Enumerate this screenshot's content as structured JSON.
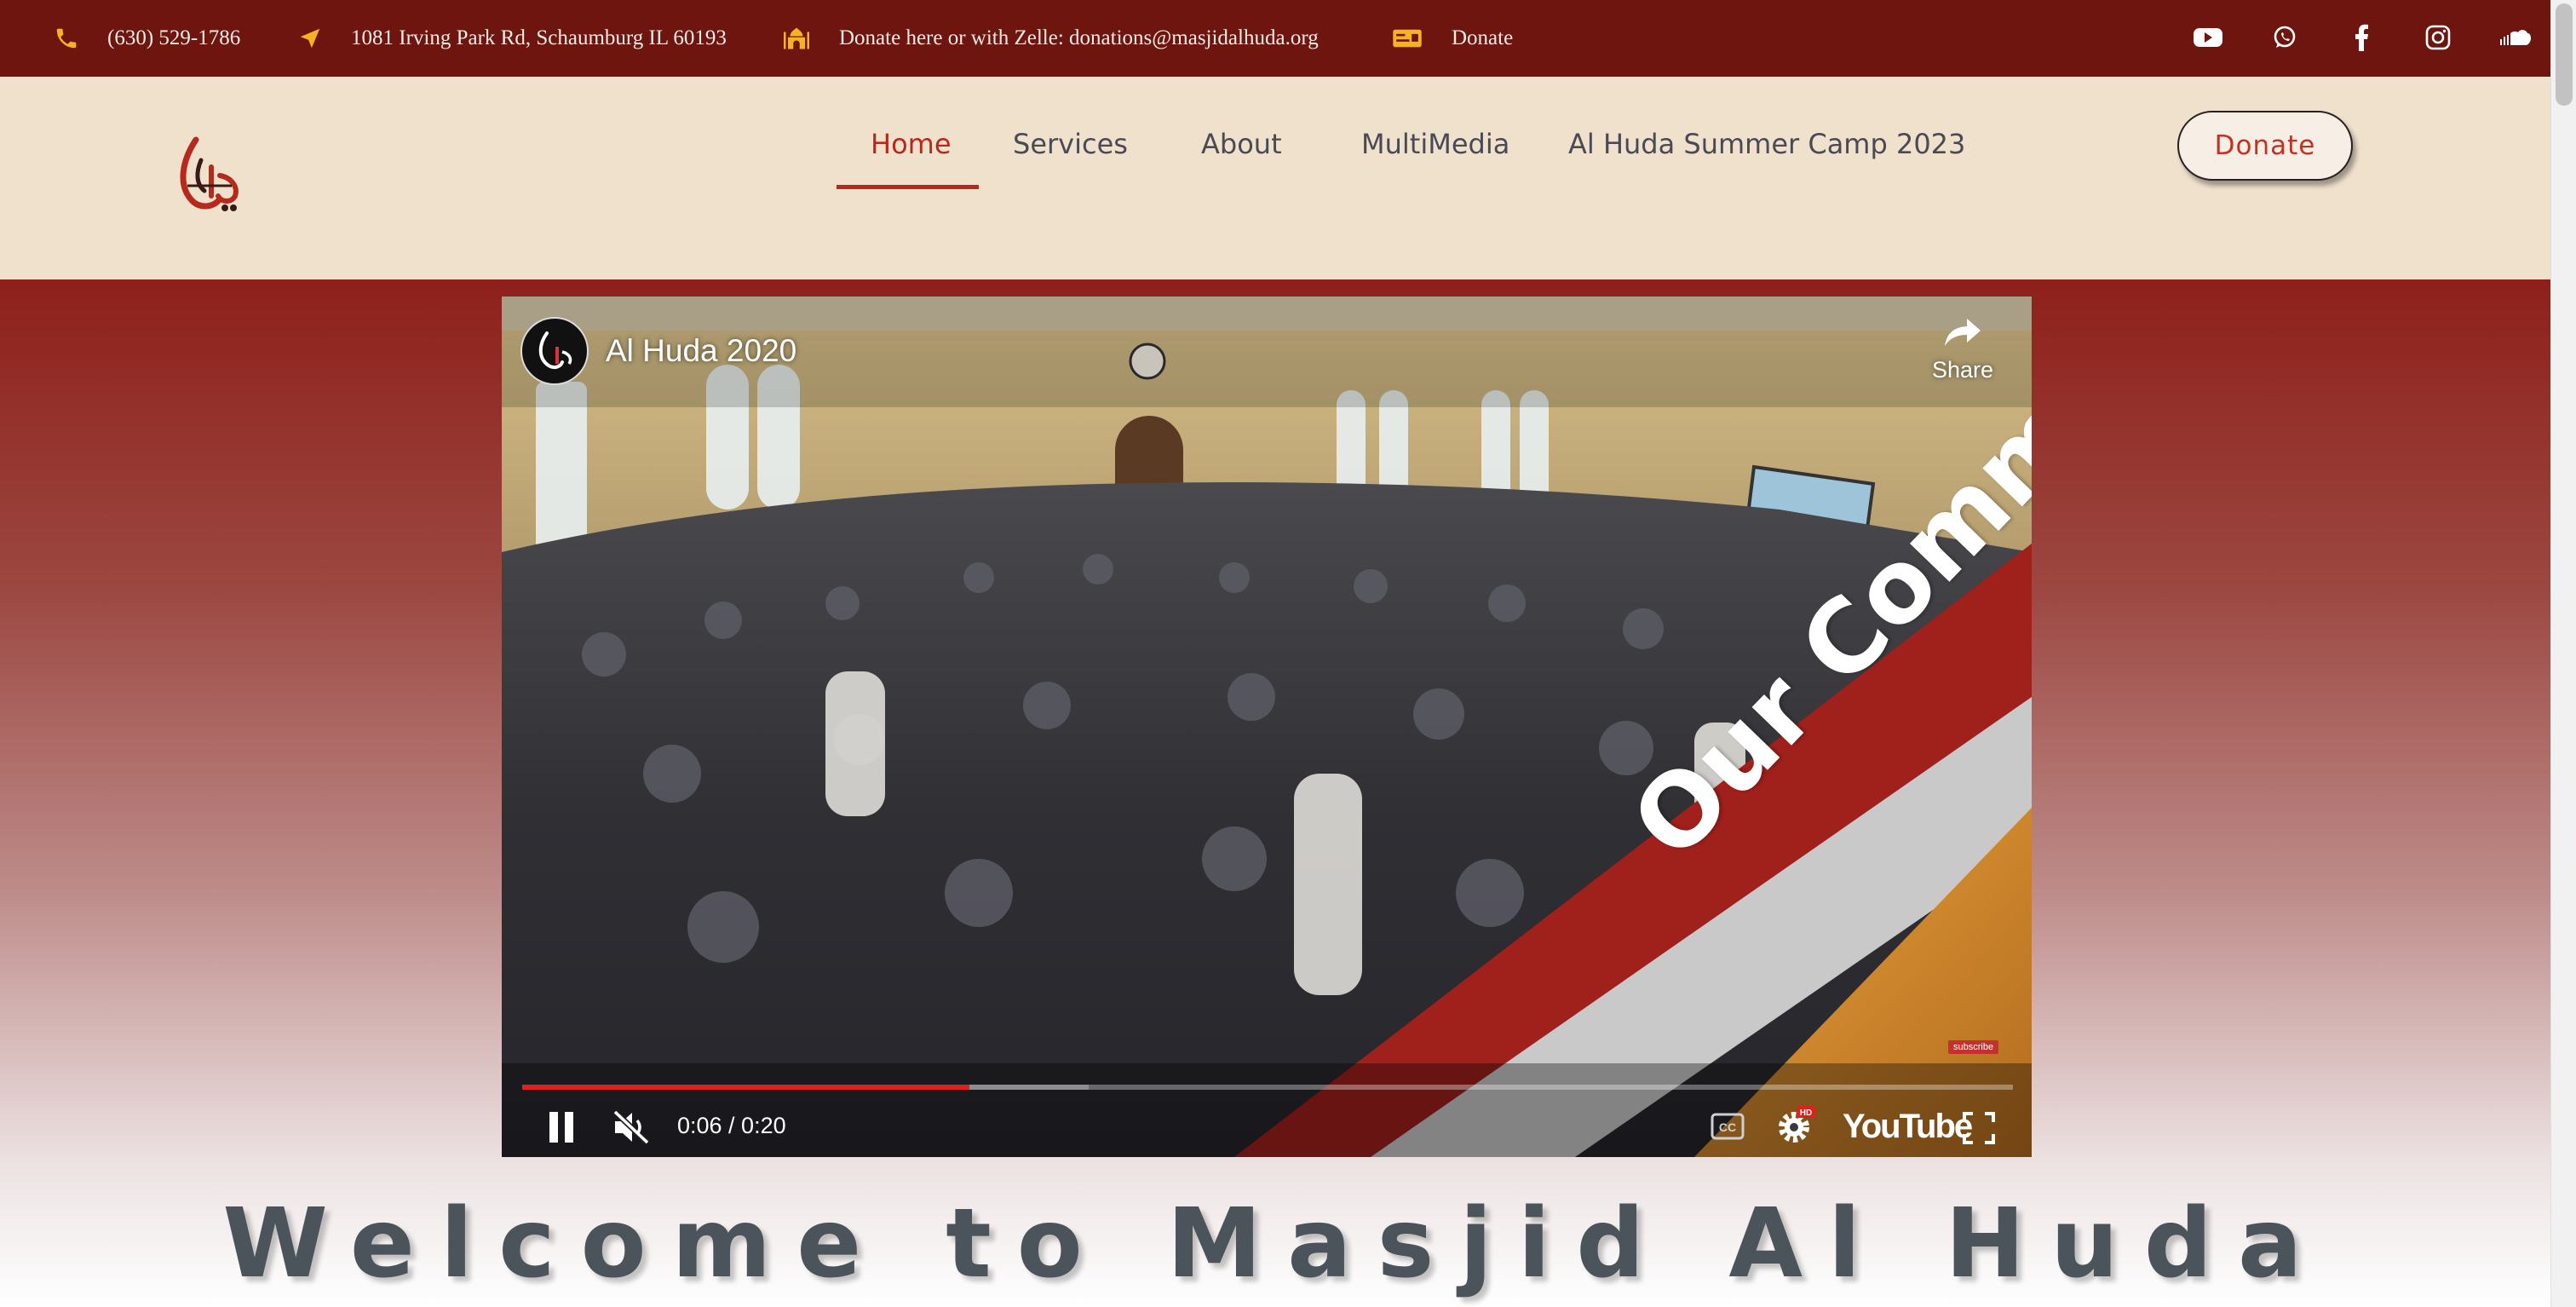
{
  "topbar": {
    "phone": "(630) 529-1786",
    "address": "1081 Irving Park Rd, Schaumburg IL 60193",
    "zelle": "Donate here or with Zelle: donations@masjidalhuda.org",
    "donate": "Donate",
    "icons": [
      "phone-icon",
      "location-arrow-icon",
      "mosque-icon",
      "money-card-icon"
    ],
    "social": [
      "youtube-icon",
      "whatsapp-icon",
      "facebook-icon",
      "instagram-icon",
      "soundcloud-icon"
    ],
    "icon_color": "#f5b324",
    "background": "#6e1510"
  },
  "header": {
    "background": "#f0e1cd",
    "nav": [
      {
        "label": "Home",
        "active": true
      },
      {
        "label": "Services"
      },
      {
        "label": "About"
      },
      {
        "label": "MultiMedia"
      },
      {
        "label": "Al Huda Summer Camp 2023"
      }
    ],
    "donate_button": "Donate",
    "accent": "#b52a1c"
  },
  "video": {
    "title": "Al Huda 2020",
    "share_label": "Share",
    "banner_text": "Our Community",
    "subscribe_label": "subscribe",
    "time": "0:06 / 0:20",
    "progress": 0.3,
    "buffered": 0.38,
    "youtube_label": "YouTube",
    "hd_badge": "HD",
    "controls": [
      "pause-icon",
      "mute-icon",
      "captions-icon",
      "settings-icon",
      "fullscreen-icon"
    ]
  },
  "main": {
    "heading": "Welcome to Masjid Al Huda"
  }
}
